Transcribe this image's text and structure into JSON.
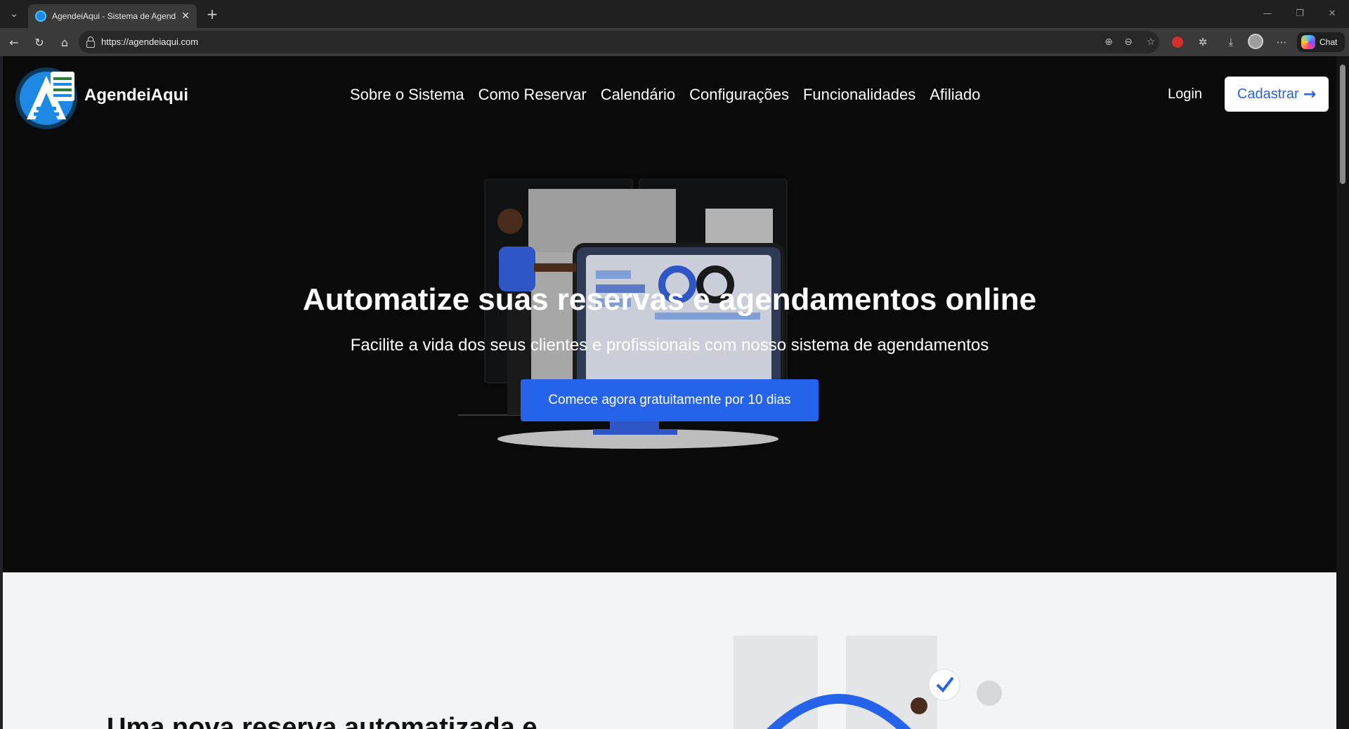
{
  "browser": {
    "tab_title": "AgendeiAqui - Sistema de Agendamento",
    "url": "https://agendeiaqui.com",
    "chat_label": "Chat",
    "icons": [
      "tab-list-icon",
      "new-tab-icon",
      "back-icon",
      "reload-icon",
      "home-icon",
      "lock-icon",
      "zoom-icon",
      "reader-icon",
      "favorite-star-icon",
      "extension-icon",
      "puzzle-icon",
      "download-icon",
      "profile-avatar",
      "more-icon",
      "copilot-icon"
    ]
  },
  "site": {
    "brand": "AgendeiAqui",
    "nav": [
      "Sobre o Sistema",
      "Como Reservar",
      "Calendário",
      "Configurações",
      "Funcionalidades",
      "Afiliado"
    ],
    "login": "Login",
    "signup": "Cadastrar",
    "accent": "#2563eb"
  },
  "hero": {
    "title": "Automatize suas reservas e agendamentos online",
    "subtitle": "Facilite a vida dos seus clientes e profissionais com nosso sistema de agendamentos",
    "cta": "Comece agora gratuitamente por 10 dias"
  },
  "section2": {
    "title": "Uma nova reserva automatizada e"
  }
}
